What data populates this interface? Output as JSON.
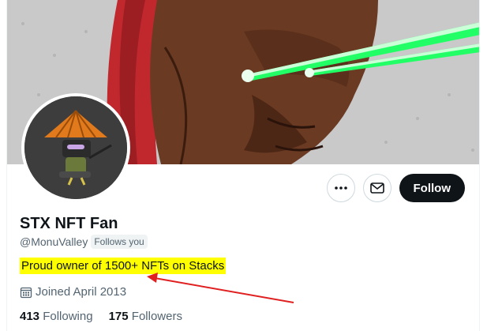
{
  "profile": {
    "name": "STX NFT Fan",
    "handle": "@MonuValley",
    "follows_you": "Follows you",
    "bio": "Proud owner of 1500+ NFTs on Stacks",
    "joined": "Joined April 2013",
    "following_count": "413",
    "following_label": "Following",
    "followers_count": "175",
    "followers_label": "Followers"
  },
  "actions": {
    "more_icon": "more-icon",
    "message_icon": "mail-icon",
    "follow_label": "Follow"
  },
  "colors": {
    "highlight": "#ffff00",
    "annotation_arrow": "#e02020",
    "follow_bg": "#0f1419",
    "laser": "#22ff66"
  }
}
